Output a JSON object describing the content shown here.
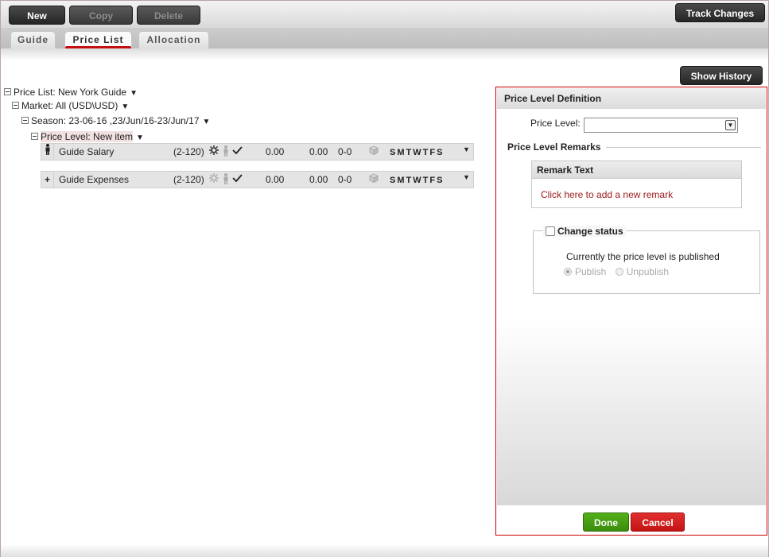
{
  "toolbar": {
    "new_label": "New",
    "copy_label": "Copy",
    "delete_label": "Delete",
    "track_changes_label": "Track Changes"
  },
  "tabs": [
    {
      "label": "Guide"
    },
    {
      "label": "Price List"
    },
    {
      "label": "Allocation"
    }
  ],
  "show_history_label": "Show History",
  "tree": {
    "price_list": "Price List: New York Guide",
    "market": "Market: All (USD\\USD)",
    "season": "Season: 23-06-16 ,23/Jun/16-23/Jun/17",
    "price_level": "Price Level: New item"
  },
  "rows": [
    {
      "lead": "",
      "name": "Guide Salary",
      "range": "(2-120)",
      "v1": "0.00",
      "v2": "0.00",
      "v3": "0-0",
      "days": [
        "S",
        "M",
        "T",
        "W",
        "T",
        "F",
        "S"
      ]
    },
    {
      "lead": "+",
      "name": "Guide Expenses",
      "range": "(2-120)",
      "v1": "0.00",
      "v2": "0.00",
      "v3": "0-0",
      "days": [
        "S",
        "M",
        "T",
        "W",
        "T",
        "F",
        "S"
      ]
    }
  ],
  "panel": {
    "title": "Price Level Definition",
    "price_level_label": "Price Level:",
    "price_level_value": "",
    "remarks_title": "Price Level Remarks",
    "remark_header": "Remark Text",
    "remark_link": "Click here to add a new remark",
    "change_status_label": "Change status",
    "status_text": "Currently the price level is published",
    "publish_label": "Publish",
    "unpublish_label": "Unpublish"
  },
  "done_label": "Done",
  "cancel_label": "Cancel"
}
